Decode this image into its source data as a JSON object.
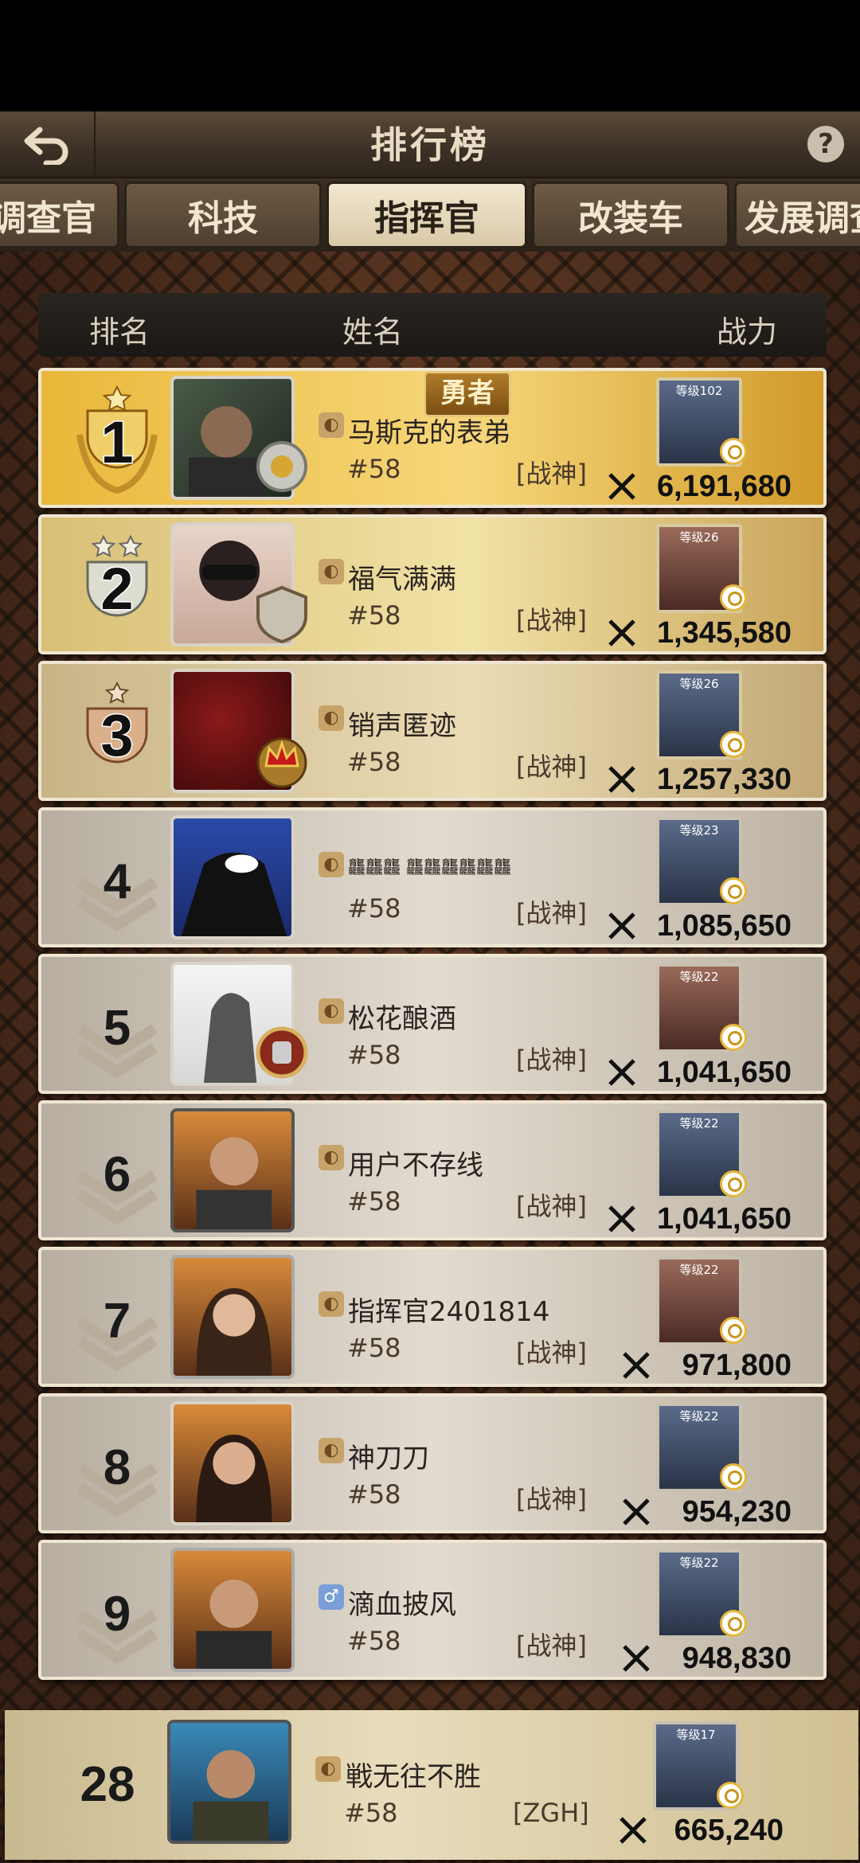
{
  "header": {
    "title": "排行榜",
    "help_label": "?"
  },
  "tabs": [
    {
      "label": "调查官",
      "active": false
    },
    {
      "label": "科技",
      "active": false
    },
    {
      "label": "指挥官",
      "active": true
    },
    {
      "label": "改装车",
      "active": false
    },
    {
      "label": "发展调查",
      "active": false
    }
  ],
  "columns": {
    "rank": "排名",
    "name": "姓名",
    "power": "战力"
  },
  "title_banner": "勇者",
  "rows": [
    {
      "rank": "1",
      "name": "马斯克的表弟",
      "server": "#58",
      "alliance": "[战神]",
      "hero_level": "等级102",
      "power": "6,191,680"
    },
    {
      "rank": "2",
      "name": "福气满满",
      "server": "#58",
      "alliance": "[战神]",
      "hero_level": "等级26",
      "power": "1,345,580"
    },
    {
      "rank": "3",
      "name": "销声匿迹",
      "server": "#58",
      "alliance": "[战神]",
      "hero_level": "等级26",
      "power": "1,257,330"
    },
    {
      "rank": "4",
      "name": "龘龘龘 龘龘龘龘龘龘",
      "server": "#58",
      "alliance": "[战神]",
      "hero_level": "等级23",
      "power": "1,085,650"
    },
    {
      "rank": "5",
      "name": "松花酿酒",
      "server": "#58",
      "alliance": "[战神]",
      "hero_level": "等级22",
      "power": "1,041,650"
    },
    {
      "rank": "6",
      "name": "用户不存线",
      "server": "#58",
      "alliance": "[战神]",
      "hero_level": "等级22",
      "power": "1,041,650"
    },
    {
      "rank": "7",
      "name": "指挥官2401814",
      "server": "#58",
      "alliance": "[战神]",
      "hero_level": "等级22",
      "power": "971,800"
    },
    {
      "rank": "8",
      "name": "神刀刀",
      "server": "#58",
      "alliance": "[战神]",
      "hero_level": "等级22",
      "power": "954,230"
    },
    {
      "rank": "9",
      "name": "滴血披风",
      "server": "#58",
      "alliance": "[战神]",
      "hero_level": "等级22",
      "power": "948,830"
    }
  ],
  "self_row": {
    "rank": "28",
    "name": "戦无往不胜",
    "server": "#58",
    "alliance": "[ZGH]",
    "hero_level": "等级17",
    "power": "665,240"
  },
  "colors": {
    "gold": "#e9b83a",
    "header_bg": "#3b3026",
    "active_tab": "#f2e7d0"
  }
}
